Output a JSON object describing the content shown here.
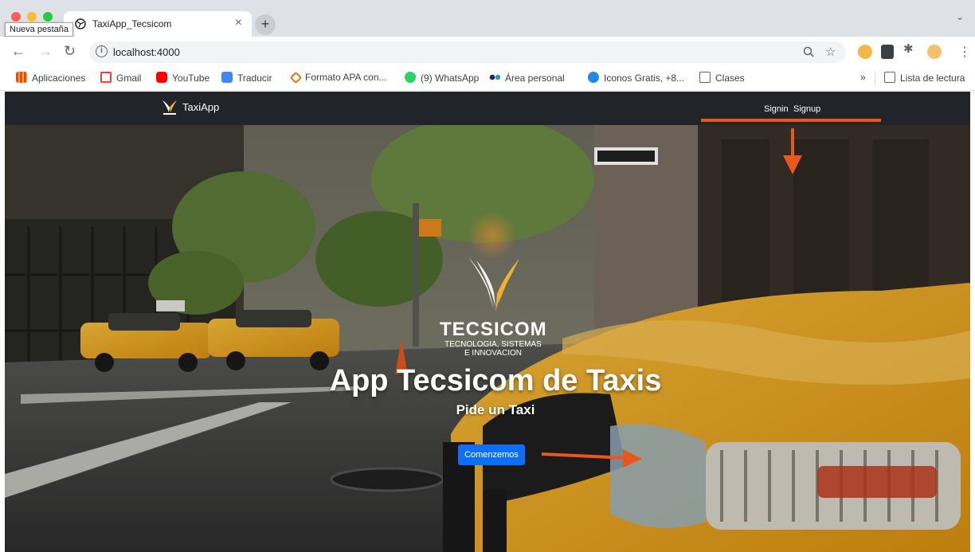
{
  "browser": {
    "tab_title": "TaxiApp_Tecsicom",
    "tab_close": "×",
    "new_tab": "+",
    "tooltip": "Nueva pestaña",
    "tabs_menu": "⌄",
    "url": "localhost:4000",
    "info_symbol": "i"
  },
  "bookmarks": {
    "items": [
      {
        "label": "Aplicaciones",
        "icon": "apps-grid-icon",
        "color": "#4285f4"
      },
      {
        "label": "Gmail",
        "icon": "gmail-icon",
        "color": "#ea4335"
      },
      {
        "label": "YouTube",
        "icon": "youtube-icon",
        "color": "#ff0000"
      },
      {
        "label": "Traducir",
        "icon": "translate-icon",
        "color": "#4285f4"
      },
      {
        "label": "Formato APA con...",
        "icon": "apa-icon",
        "color": "#e8710a"
      },
      {
        "label": "(9) WhatsApp",
        "icon": "whatsapp-icon",
        "color": "#25d366"
      },
      {
        "label": "Área personal",
        "icon": "area-personal-icon",
        "color": "#1a237e"
      },
      {
        "label": "Iconos Gratis, +8...",
        "icon": "iconos-icon",
        "color": "#1e88e5"
      },
      {
        "label": "Clases",
        "icon": "folder-icon",
        "color": "#5f6368"
      }
    ],
    "overflow": "»",
    "reading_list": "Lista de lectura"
  },
  "site": {
    "brand": "TaxiApp",
    "nav": {
      "signin": "Signin",
      "signup": "Signup"
    },
    "logo_name": "TECSICOM",
    "logo_tag1": "TECNOLOGIA, SISTEMAS",
    "logo_tag2": "E INNOVACION",
    "hero_title": "App Tecsicom de Taxis",
    "hero_subtitle": "Pide un Taxi",
    "cta": "Comenzemos"
  },
  "colors": {
    "navbar": "#212529",
    "button": "#0d6efd",
    "annotation_arrow": "#e8581c",
    "taxi": "#f2b01e"
  }
}
